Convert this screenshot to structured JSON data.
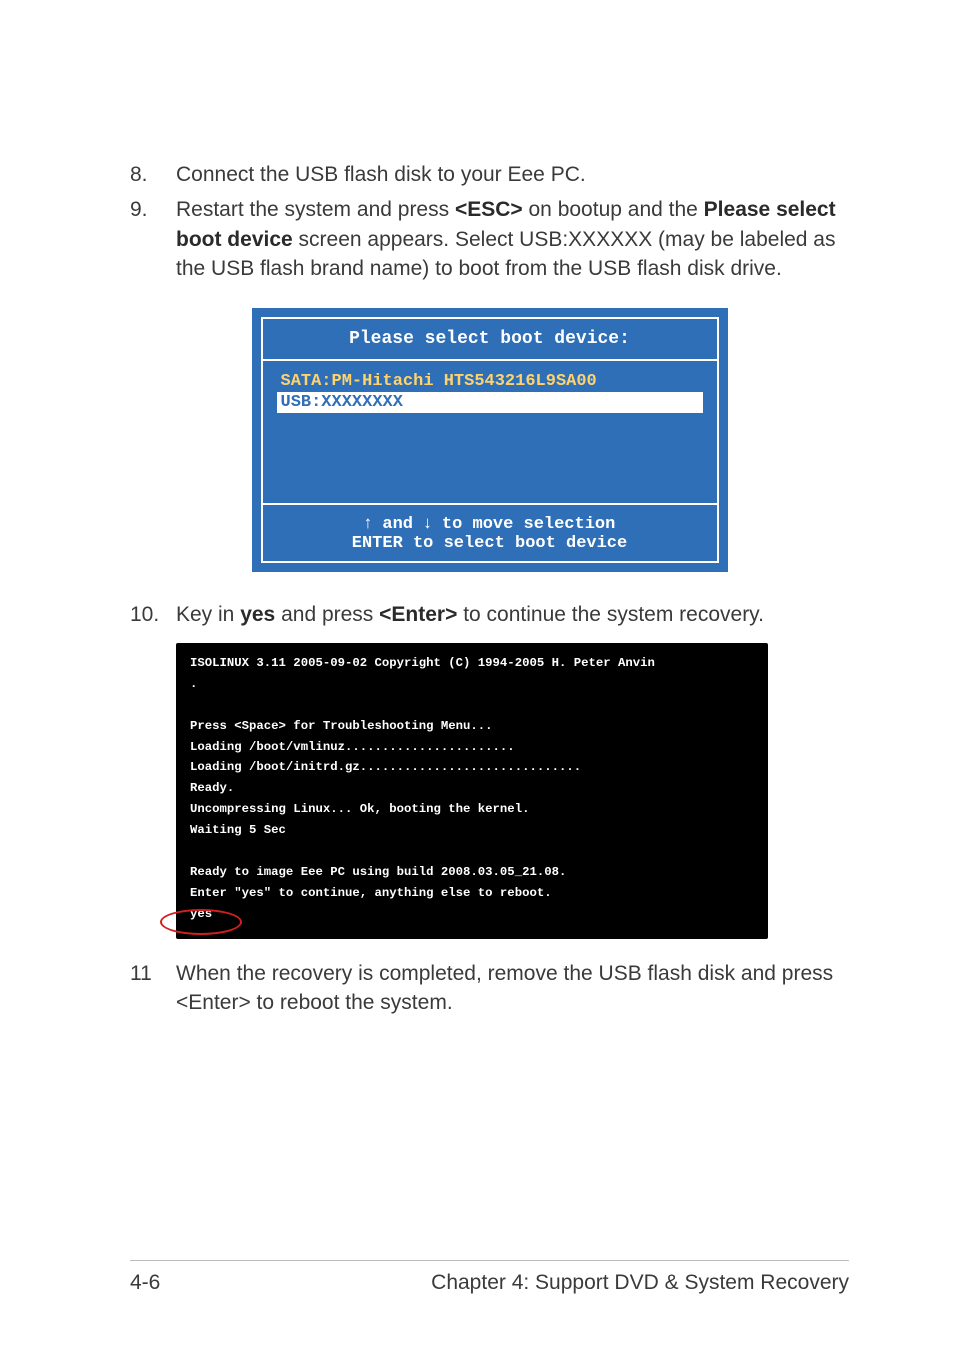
{
  "steps": {
    "s8": {
      "num": "8.",
      "text_a": "Connect the USB flash disk to your Eee PC."
    },
    "s9": {
      "num": "9.",
      "text_a": "Restart the system and press ",
      "bold_a": "<ESC>",
      "text_b": " on bootup and the ",
      "bold_b": "Please select boot device",
      "text_c": " screen appears. Select USB:XXXXXX (may be labeled as the USB flash brand name) to boot from the USB flash disk drive."
    },
    "s10": {
      "num": "10.",
      "text_a": "Key in ",
      "bold_a": "yes",
      "text_b": " and press ",
      "bold_b": "<Enter>",
      "text_c": " to continue the system recovery."
    },
    "s11": {
      "num": "11",
      "text_a": "When the recovery is completed, remove the USB flash disk and press <Enter> to reboot the system."
    }
  },
  "boot_dialog": {
    "title": "Please select boot device:",
    "items": [
      {
        "label": "SATA:PM-Hitachi HTS543216L9SA00",
        "selected": false
      },
      {
        "label": "USB:XXXXXXXX",
        "selected": true
      }
    ],
    "footer_line1_pre": "  and ",
    "footer_line1_mid": " to move selection",
    "footer_line2": "ENTER to select boot device"
  },
  "terminal": {
    "lines": [
      "ISOLINUX 3.11 2005-09-02 Copyright (C) 1994-2005 H. Peter Anvin",
      ".",
      "",
      "Press <Space> for Troubleshooting Menu...",
      "Loading /boot/vmlinuz.......................",
      "Loading /boot/initrd.gz..............................",
      "Ready.",
      "Uncompressing Linux... Ok, booting the kernel.",
      "Waiting 5 Sec",
      "",
      "Ready to image Eee PC using build 2008.03.05_21.08.",
      "Enter \"yes\" to continue, anything else to reboot.",
      "yes"
    ]
  },
  "footer": {
    "page_num": "4-6",
    "chapter": "Chapter 4: Support DVD & System Recovery"
  }
}
